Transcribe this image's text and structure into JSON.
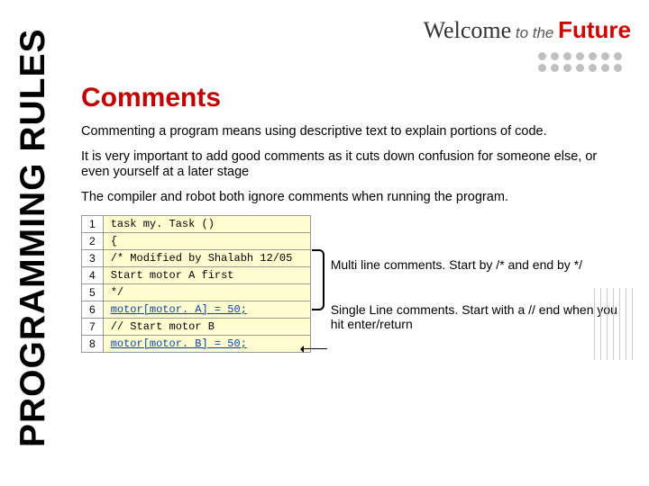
{
  "sidebar": {
    "vertical_title": "PROGRAMMING RULES"
  },
  "header": {
    "welcome": "Welcome",
    "to": " to the ",
    "future": "Future"
  },
  "main": {
    "title": "Comments",
    "para1": "Commenting a program means using descriptive text to explain portions of code.",
    "para2": "It is very important to add good comments as it cuts down confusion for someone else, or even yourself at a later stage",
    "para3": "The compiler and robot both ignore comments when running the program."
  },
  "code": {
    "rows": [
      {
        "n": "1",
        "t": "task my. Task ()"
      },
      {
        "n": "2",
        "t": "{"
      },
      {
        "n": "3",
        "t": "/* Modified by Shalabh 12/05"
      },
      {
        "n": "4",
        "t": "Start motor A first"
      },
      {
        "n": "5",
        "t": "*/"
      },
      {
        "n": "6",
        "t": "motor[motor. A] = 50;"
      },
      {
        "n": "7",
        "t": "// Start motor B"
      },
      {
        "n": "8",
        "t": "motor[motor. B] = 50;"
      }
    ]
  },
  "annotations": {
    "multi": "Multi line comments. Start by /* and end by */",
    "single": "Single Line comments. Start with a //   end when you hit enter/return"
  }
}
